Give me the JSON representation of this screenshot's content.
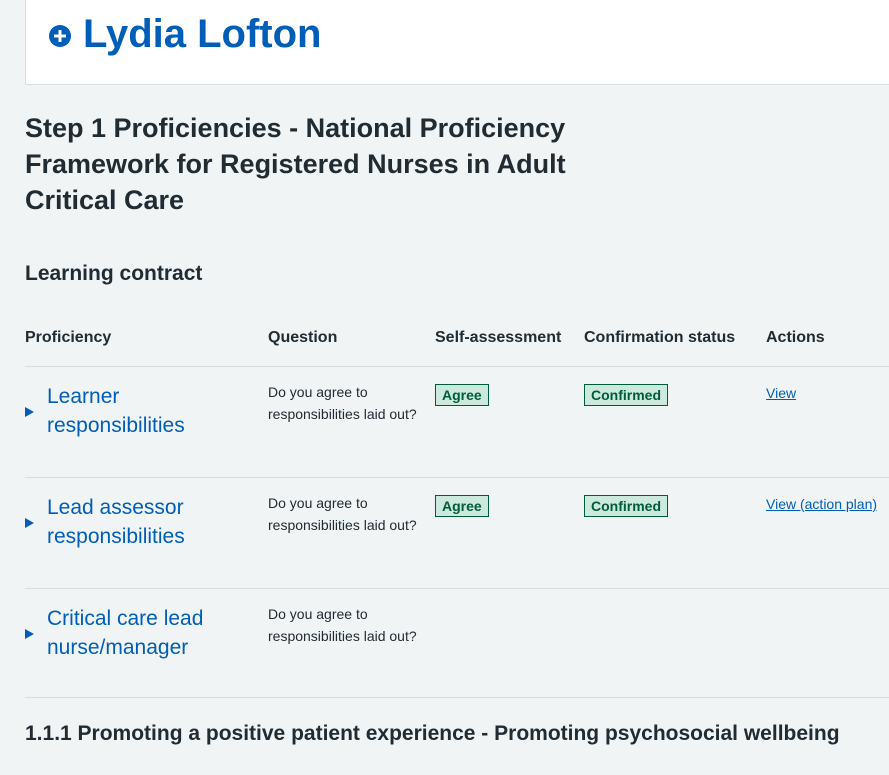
{
  "header": {
    "name": "Lydia Lofton",
    "icon": "plus-circle-icon"
  },
  "page_title": "Step 1 Proficiencies - National Proficiency Framework for Registered Nurses in Adult Critical Care",
  "section_title": "Learning contract",
  "table": {
    "columns": [
      "Proficiency",
      "Question",
      "Self-assessment",
      "Confirmation status",
      "Actions"
    ],
    "rows": [
      {
        "proficiency": "Learner responsibilities",
        "question": "Do you agree to responsibilities laid out?",
        "self_assessment": "Agree",
        "confirmation_status": "Confirmed",
        "action": "View"
      },
      {
        "proficiency": "Lead assessor responsibilities",
        "question": "Do you agree to responsibilities laid out?",
        "self_assessment": "Agree",
        "confirmation_status": "Confirmed",
        "action": "View (action plan)"
      },
      {
        "proficiency": "Critical care lead nurse/manager",
        "question": "Do you agree to responsibilities laid out?",
        "self_assessment": "",
        "confirmation_status": "",
        "action": ""
      }
    ]
  },
  "next_section_title": "1.1.1 Promoting a positive patient experience - Promoting psychosocial wellbeing",
  "colors": {
    "brand_blue": "#005eb8",
    "tag_green_bg": "#cce9dd",
    "tag_green_text": "#005a3c",
    "page_bg": "#f0f4f5"
  }
}
